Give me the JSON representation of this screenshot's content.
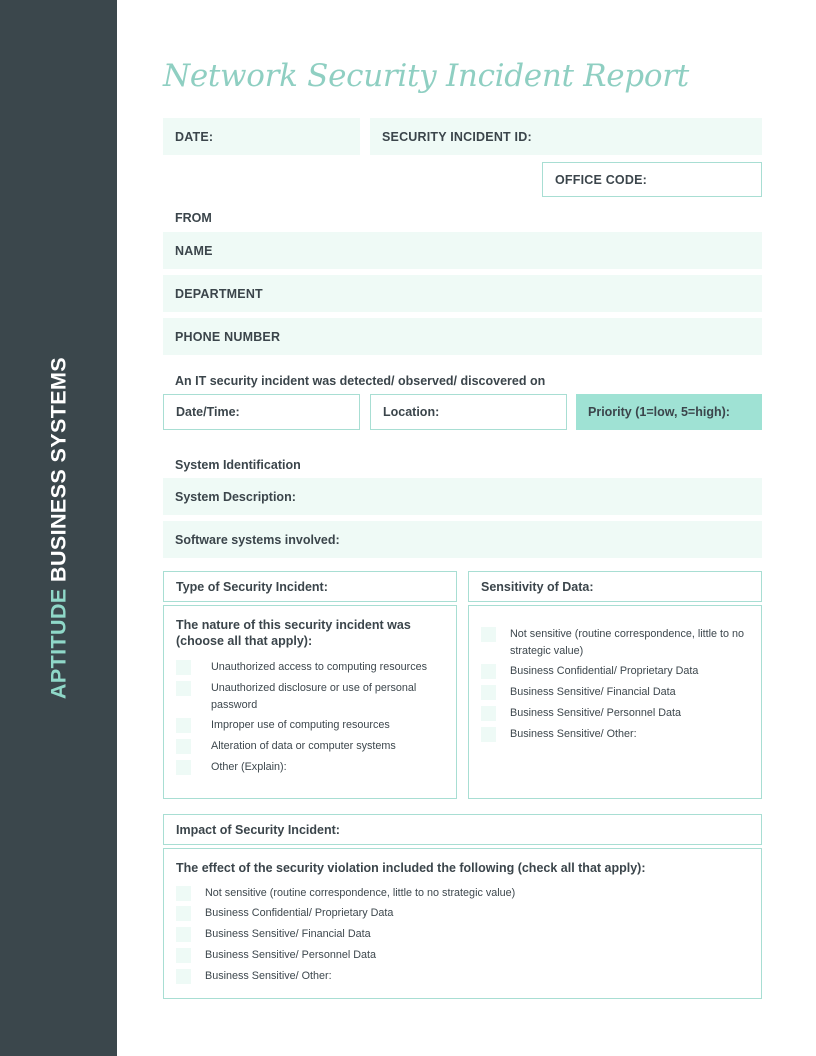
{
  "sidebar": {
    "brand_primary": "APTITUDE",
    "brand_secondary": "BUSINESS SYSTEMS"
  },
  "document": {
    "title": "Network Security Incident Report"
  },
  "header_fields": {
    "date_label": "DATE:",
    "incident_id_label": "SECURITY INCIDENT ID:",
    "office_code_label": "OFFICE CODE:"
  },
  "from_section": {
    "heading": "FROM",
    "name_label": "NAME",
    "department_label": "DEPARTMENT",
    "phone_label": "PHONE NUMBER"
  },
  "detection": {
    "intro": "An IT security incident was detected/ observed/ discovered on",
    "datetime_label": "Date/Time:",
    "location_label": "Location:",
    "priority_label": "Priority (1=low, 5=high):"
  },
  "system_identification": {
    "heading": "System Identification",
    "system_description_label": "System Description:",
    "software_label": "Software systems involved:"
  },
  "type_of_incident": {
    "heading": "Type of Security Incident:",
    "intro": "The nature of this security incident was (choose all that apply):",
    "options": [
      "Unauthorized access to computing resources",
      "Unauthorized disclosure or use of personal password",
      "Improper use of computing resources",
      "Alteration of data or computer systems",
      "Other (Explain):"
    ]
  },
  "sensitivity_of_data": {
    "heading": "Sensitivity of Data:",
    "options": [
      "Not sensitive (routine correspondence, little to no strategic value)",
      "Business Confidential/ Proprietary Data",
      "Business Sensitive/ Financial Data",
      "Business Sensitive/ Personnel Data",
      "Business Sensitive/ Other:"
    ]
  },
  "impact": {
    "heading": "Impact of Security Incident:",
    "intro": "The effect of the security violation included the following (check all that apply):",
    "options": [
      "Not sensitive (routine correspondence, little to no strategic value)",
      "Business Confidential/ Proprietary Data",
      "Business Sensitive/ Financial Data",
      "Business Sensitive/ Personnel Data",
      "Business Sensitive/ Other:"
    ]
  },
  "colors": {
    "sidebar_bg": "#3b474c",
    "accent_teal": "#8fcfc2",
    "fill_mint": "#effaf6",
    "border_mint": "#a8ded3",
    "priority_solid": "#9fe2d4",
    "text_dark": "#3b454b"
  }
}
